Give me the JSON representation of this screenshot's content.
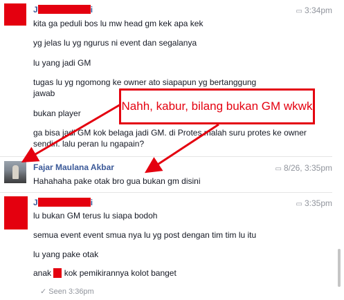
{
  "conversation": [
    {
      "sender_visible": "J",
      "sender_suffix": "i",
      "time": "3:34pm",
      "messages": [
        "kita ga peduli bos lu mw head gm kek apa kek",
        "yg jelas lu yg ngurus ni event dan segalanya",
        "lu yang jadi GM",
        "tugas lu yg ngomong ke owner ato siapapun yg bertanggung jawab",
        "bukan player",
        "ga bisa jadi GM kok belaga jadi GM. di Protes malah suru protes ke owner sendiri. lalu peran lu ngapain?"
      ]
    },
    {
      "sender": "Fajar Maulana Akbar",
      "time": "8/26, 3:35pm",
      "messages": [
        "Hahahaha pake otak bro gua bukan gm disini"
      ]
    },
    {
      "sender_visible": "J",
      "sender_suffix": "i",
      "time": "3:35pm",
      "messages": [
        "lu bukan GM terus lu siapa bodoh",
        "semua event event smua nya lu yg post dengan tim tim lu itu",
        "lu yang pake otak",
        "anak",
        "kok pemikirannya kolot banget"
      ]
    }
  ],
  "seen": "Seen 3:36pm",
  "annotation": {
    "text": "Nahh, kabur, bilang bukan GM wkwk",
    "color": "#e4000f"
  },
  "colors": {
    "name": "#3b5998",
    "redaction": "#e4000f",
    "meta": "#90949c"
  },
  "icons": [
    "chat-bubble-icon",
    "check-icon"
  ]
}
